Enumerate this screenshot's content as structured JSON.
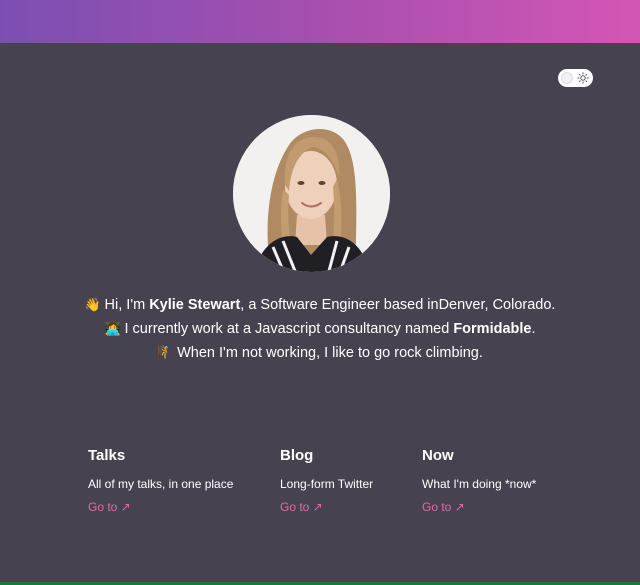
{
  "intro": {
    "greeting_prefix": "Hi, I'm ",
    "name": "Kylie Stewart",
    "greeting_suffix": ", a Software Engineer based inDenver, Colorado.",
    "work_prefix": "I currently work at a Javascript consultancy named ",
    "company": "Formidable",
    "work_suffix": ".",
    "hobby": "When I'm not working, I like to go rock climbing.",
    "emoji_wave": "👋",
    "emoji_work": "👩‍💻",
    "emoji_climb": "🧗"
  },
  "cards": [
    {
      "title": "Talks",
      "description": "All of my talks, in one place",
      "link": "Go to ↗"
    },
    {
      "title": "Blog",
      "description": "Long-form Twitter",
      "link": "Go to ↗"
    },
    {
      "title": "Now",
      "description": "What I'm doing *now*",
      "link": "Go to ↗"
    }
  ],
  "colors": {
    "background": "#46424f",
    "gradient_start": "#7b4fb2",
    "gradient_end": "#d456b4",
    "link": "#e06aa8"
  },
  "icons": {
    "toggle": "sun-icon"
  }
}
